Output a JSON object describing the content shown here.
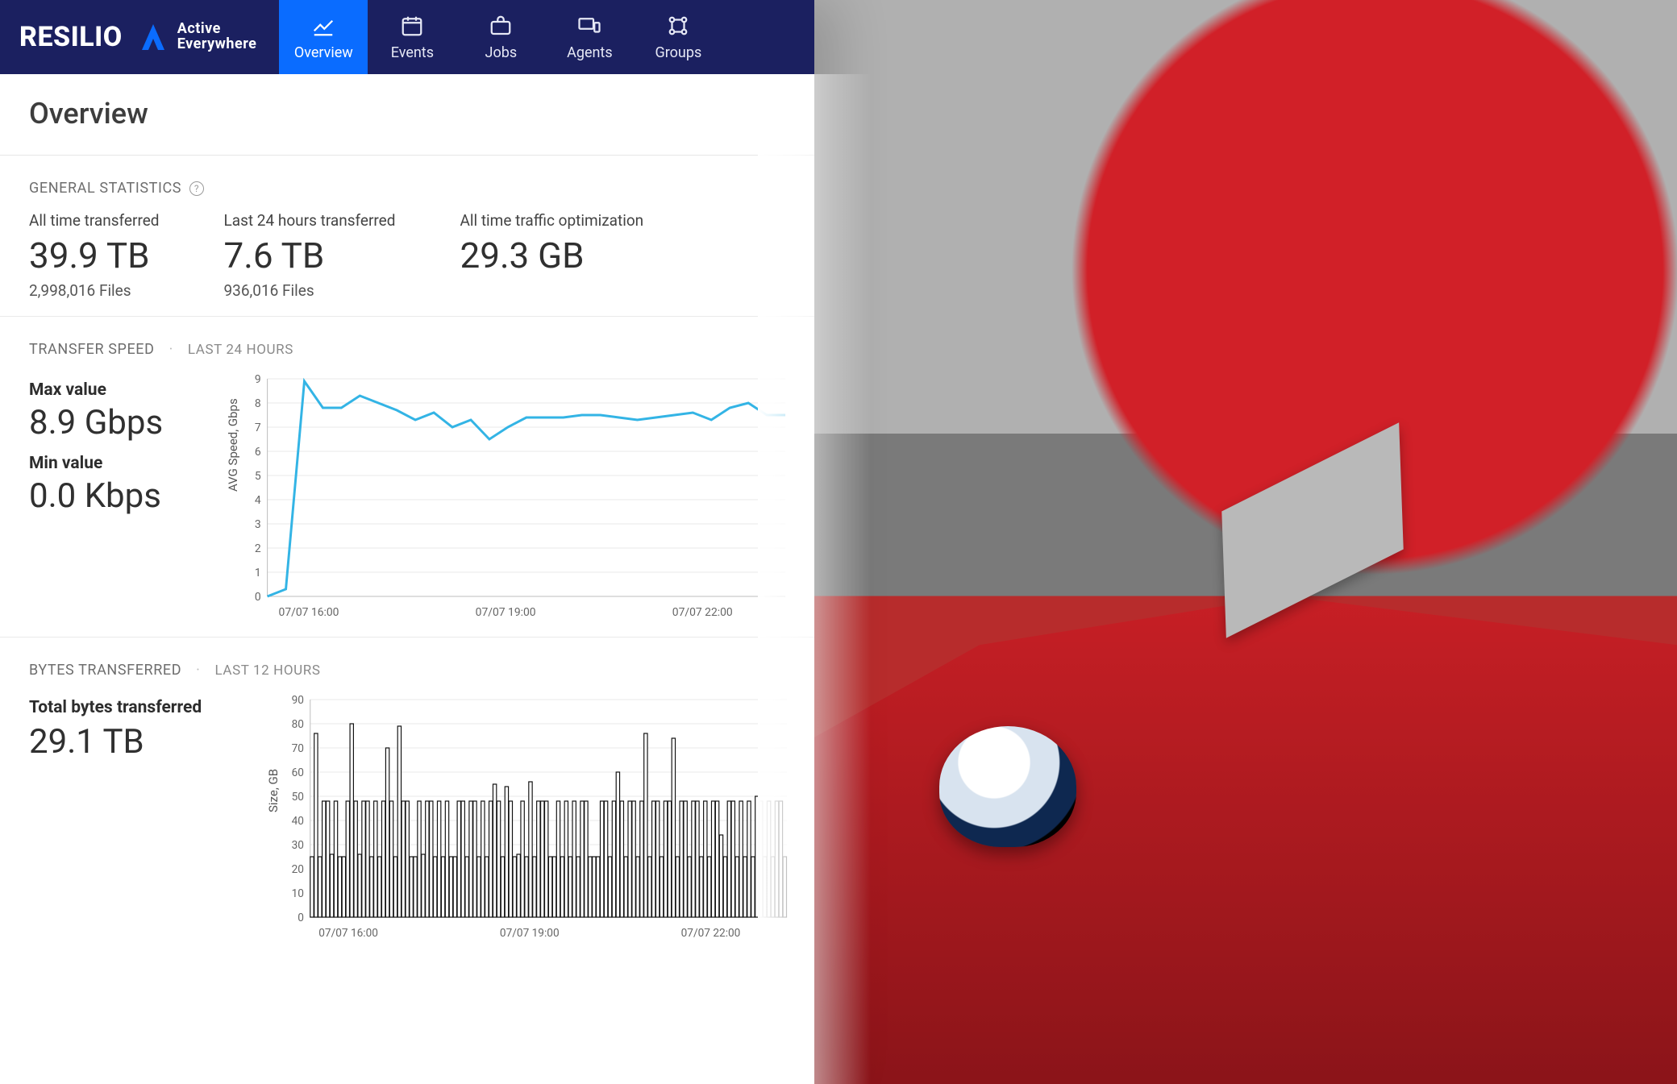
{
  "brand": {
    "name": "RESILIO",
    "tag1": "Active",
    "tag2": "Everywhere"
  },
  "nav": {
    "items": [
      {
        "label": "Overview",
        "active": true
      },
      {
        "label": "Events",
        "active": false
      },
      {
        "label": "Jobs",
        "active": false
      },
      {
        "label": "Agents",
        "active": false
      },
      {
        "label": "Groups",
        "active": false
      }
    ]
  },
  "page": {
    "title": "Overview"
  },
  "general": {
    "heading": "GENERAL STATISTICS",
    "stats": [
      {
        "label": "All time transferred",
        "value": "39.9 TB",
        "sub": "2,998,016 Files"
      },
      {
        "label": "Last 24 hours transferred",
        "value": "7.6 TB",
        "sub": "936,016 Files"
      },
      {
        "label": "All time traffic optimization",
        "value": "29.3 GB",
        "sub": ""
      }
    ]
  },
  "speed": {
    "heading": "TRANSFER SPEED",
    "range": "LAST 24 HOURS",
    "max_label": "Max value",
    "max_value": "8.9 Gbps",
    "min_label": "Min value",
    "min_value": "0.0 Kbps"
  },
  "bytes": {
    "heading": "BYTES TRANSFERRED",
    "range": "LAST 12 HOURS",
    "total_label": "Total bytes transferred",
    "total_value": "29.1 TB"
  },
  "chart_data": [
    {
      "type": "line",
      "title": "Transfer Speed",
      "ylabel": "AVG Speed, Gbps",
      "ylim": [
        0,
        9
      ],
      "yticks": [
        0,
        1,
        2,
        3,
        4,
        5,
        6,
        7,
        8,
        9
      ],
      "x_labels": [
        "07/07 16:00",
        "07/07 19:00",
        "07/07 22:00"
      ],
      "x": [
        0,
        1,
        2,
        3,
        4,
        5,
        6,
        7,
        8,
        9,
        10,
        11,
        12,
        13,
        14,
        15,
        16,
        17,
        18,
        19,
        20,
        21,
        22,
        23,
        24,
        25,
        26,
        27,
        28
      ],
      "series": [
        {
          "name": "AVG Speed",
          "values": [
            0,
            0.3,
            8.9,
            7.8,
            7.8,
            8.3,
            8.0,
            7.7,
            7.3,
            7.6,
            7.0,
            7.3,
            6.5,
            7.0,
            7.4,
            7.4,
            7.4,
            7.5,
            7.5,
            7.4,
            7.3,
            7.4,
            7.5,
            7.6,
            7.3,
            7.8,
            8.0,
            7.5,
            7.5
          ]
        }
      ]
    },
    {
      "type": "bar",
      "title": "Bytes Transferred",
      "ylabel": "Size, GB",
      "ylim": [
        0,
        90
      ],
      "yticks": [
        0,
        10,
        20,
        30,
        40,
        50,
        60,
        70,
        80,
        90
      ],
      "x_labels": [
        "07/07 16:00",
        "07/07 19:00",
        "07/07 22:00"
      ],
      "categories_count": 120,
      "values": [
        25,
        76,
        25,
        48,
        48,
        26,
        48,
        25,
        25,
        48,
        80,
        48,
        26,
        48,
        48,
        25,
        48,
        25,
        48,
        70,
        48,
        25,
        79,
        48,
        48,
        25,
        25,
        48,
        26,
        48,
        48,
        25,
        48,
        25,
        48,
        25,
        25,
        48,
        48,
        25,
        48,
        48,
        25,
        48,
        25,
        48,
        55,
        48,
        25,
        54,
        48,
        25,
        26,
        48,
        25,
        56,
        25,
        48,
        48,
        48,
        25,
        25,
        48,
        25,
        48,
        25,
        48,
        25,
        48,
        48,
        25,
        25,
        25,
        48,
        48,
        25,
        48,
        60,
        48,
        25,
        48,
        48,
        25,
        48,
        76,
        25,
        48,
        48,
        25,
        48,
        48,
        74,
        25,
        48,
        48,
        25,
        48,
        48,
        25,
        48,
        25,
        48,
        48,
        34,
        25,
        48,
        48,
        25,
        48,
        25,
        48,
        25,
        50,
        48,
        25,
        48,
        25,
        48,
        48,
        25
      ]
    }
  ]
}
